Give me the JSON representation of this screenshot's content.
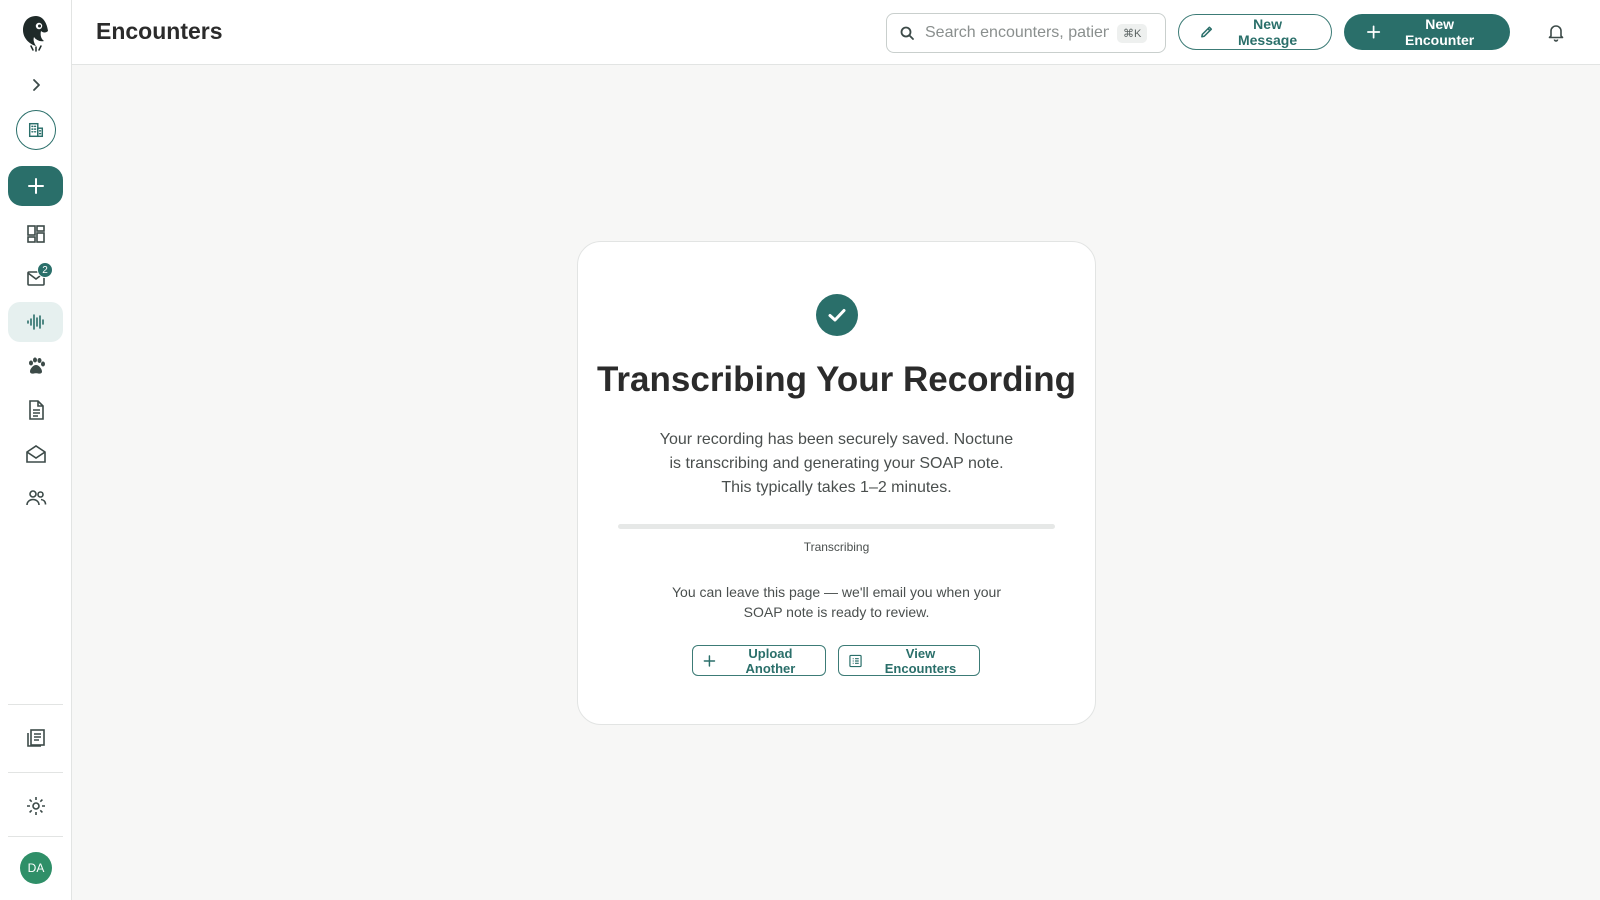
{
  "header": {
    "title": "Encounters",
    "search_placeholder": "Search encounters, patients…",
    "search_shortcut": "⌘K",
    "new_message_label": "New Message",
    "new_encounter_label": "New Encounter"
  },
  "sidebar": {
    "inbox_badge": "2",
    "avatar_initials": "DA",
    "items": [
      {
        "name": "logo",
        "icon": "owl-logo-icon"
      },
      {
        "name": "expand",
        "icon": "chevron-right-icon"
      },
      {
        "name": "organization",
        "icon": "building-icon"
      },
      {
        "name": "new",
        "icon": "plus-icon"
      },
      {
        "name": "dashboard",
        "icon": "dashboard-icon"
      },
      {
        "name": "inbox",
        "icon": "inbox-icon"
      },
      {
        "name": "recordings",
        "icon": "waveform-icon",
        "active": true
      },
      {
        "name": "patients",
        "icon": "paw-icon"
      },
      {
        "name": "documents",
        "icon": "document-icon"
      },
      {
        "name": "mail",
        "icon": "mail-open-icon"
      },
      {
        "name": "team",
        "icon": "people-icon"
      },
      {
        "name": "notes",
        "icon": "notes-icon"
      },
      {
        "name": "settings",
        "icon": "gear-icon"
      }
    ]
  },
  "card": {
    "title": "Transcribing Your Recording",
    "description": "Your recording has been securely saved. Noctune is transcribing and generating your SOAP note. This typically takes 1–2 minutes.",
    "progress_label": "Transcribing",
    "progress_percent": 0,
    "note": "You can leave this page — we'll email you when your SOAP note is ready to review.",
    "upload_another_label": "Upload Another",
    "view_encounters_label": "View Encounters"
  },
  "colors": {
    "accent": "#2a6f6a",
    "accent_light": "#e6f0ef",
    "avatar": "#2f8f68",
    "background": "#f7f7f6"
  }
}
